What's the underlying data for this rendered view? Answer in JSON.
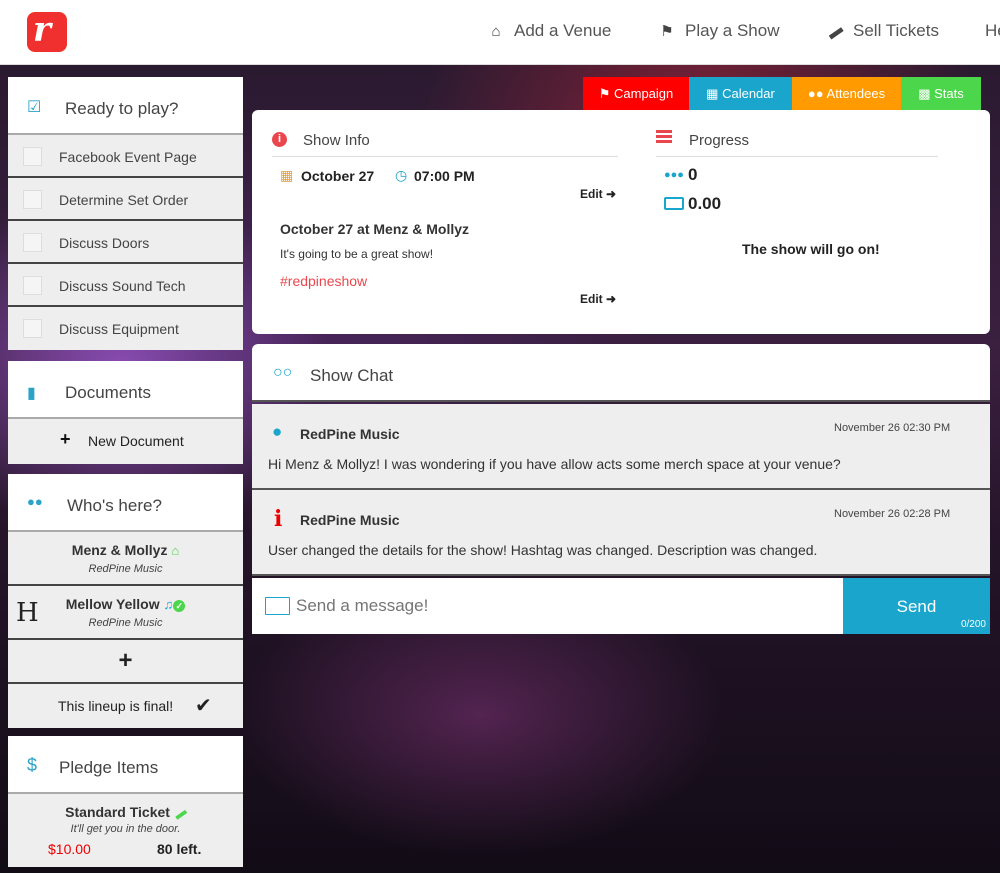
{
  "nav": {
    "logo_letter": "r",
    "items": [
      {
        "label": "Add a Venue",
        "icon": "home-icon"
      },
      {
        "label": "Play a Show",
        "icon": "flag-icon"
      },
      {
        "label": "Sell Tickets",
        "icon": "ticket-icon"
      },
      {
        "label": "He",
        "icon": ""
      }
    ]
  },
  "tabs": [
    {
      "label": "Campaign",
      "icon": "flag-icon",
      "color": "#ff0000"
    },
    {
      "label": "Calendar",
      "icon": "calendar-icon",
      "color": "#19a5cc"
    },
    {
      "label": "Attendees",
      "icon": "users-icon",
      "color": "#ff9a00"
    },
    {
      "label": "Stats",
      "icon": "bar-chart-icon",
      "color": "#4cd64c"
    }
  ],
  "ready": {
    "title": "Ready to play?",
    "items": [
      "Facebook Event Page",
      "Determine Set Order",
      "Discuss Doors",
      "Discuss Sound Tech",
      "Discuss Equipment"
    ]
  },
  "documents": {
    "title": "Documents",
    "new_label": "New Document"
  },
  "whos_here": {
    "title": "Who's here?",
    "acts": [
      {
        "name": "Menz & Mollyz",
        "sub": "RedPine Music"
      },
      {
        "name": "Mellow Yellow",
        "sub": "RedPine Music",
        "avatar_letter": "H"
      }
    ],
    "final_label": "This lineup is final!"
  },
  "pledge": {
    "title": "Pledge Items",
    "item": {
      "name": "Standard Ticket",
      "desc": "It'll get you in the door.",
      "price": "$10.00",
      "left": "80 left."
    }
  },
  "show_info": {
    "title": "Show Info",
    "date": "October 27",
    "time": "07:00 PM",
    "edit_label": "Edit",
    "headline": "October 27 at Menz & Mollyz",
    "description": "It's going to be a great show!",
    "hashtag": "#redpineshow"
  },
  "progress": {
    "title": "Progress",
    "attendees": "0",
    "amount": "0.00",
    "status": "The show will go on!"
  },
  "chat": {
    "title": "Show Chat",
    "messages": [
      {
        "author": "RedPine Music",
        "time": "November 26 02:30 PM",
        "text": "Hi Menz & Mollyz! I was wondering if you have allow acts some merch space at your venue?",
        "icon": "user-icon"
      },
      {
        "author": "RedPine Music",
        "time": "November 26 02:28 PM",
        "text": "User changed the details for the show! Hashtag was changed. Description was changed.",
        "icon": "info-icon"
      }
    ],
    "placeholder": "Send a message!",
    "send_label": "Send",
    "counter": "0/200"
  }
}
